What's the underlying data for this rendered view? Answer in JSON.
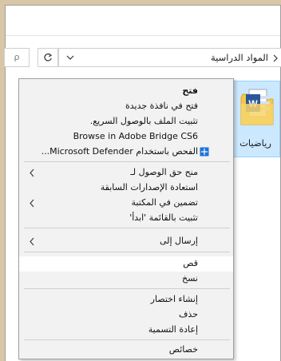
{
  "address_bar": {
    "path": "المواد الدراسية",
    "search_glyph": "ρ"
  },
  "file": {
    "name": "رياضيات",
    "icon": "word-document-in-folder-icon"
  },
  "context_menu": {
    "open": "فتح",
    "open_new_window": "فتح في نافذة جديدة",
    "pin_quick_access": "تثبيت الملف بالوصول السريع.",
    "browse_bridge": "Browse in Adobe Bridge CS6",
    "defender_scan": "الفحص باستخدام Microsoft Defender...",
    "give_access": "منح حق الوصول لـ",
    "restore_versions": "استعادة الإصدارات السابقة",
    "include_library": "تضمين في المكتبة",
    "pin_start": "تثبيت بالقائمة 'ابدأ'",
    "send_to": "إرسال إلى",
    "cut": "قص",
    "copy": "نسخ",
    "create_shortcut": "إنشاء اختصار",
    "delete": "حذف",
    "rename": "إعادة التسمية",
    "properties": "خصائص"
  },
  "colors": {
    "selection": "#cce8ff",
    "menu_bg": "#f2f2f2",
    "highlight": "#ffffff",
    "defender_blue": "#1e73d8",
    "word_blue": "#2b579a",
    "folder_yellow": "#f5c84c"
  }
}
